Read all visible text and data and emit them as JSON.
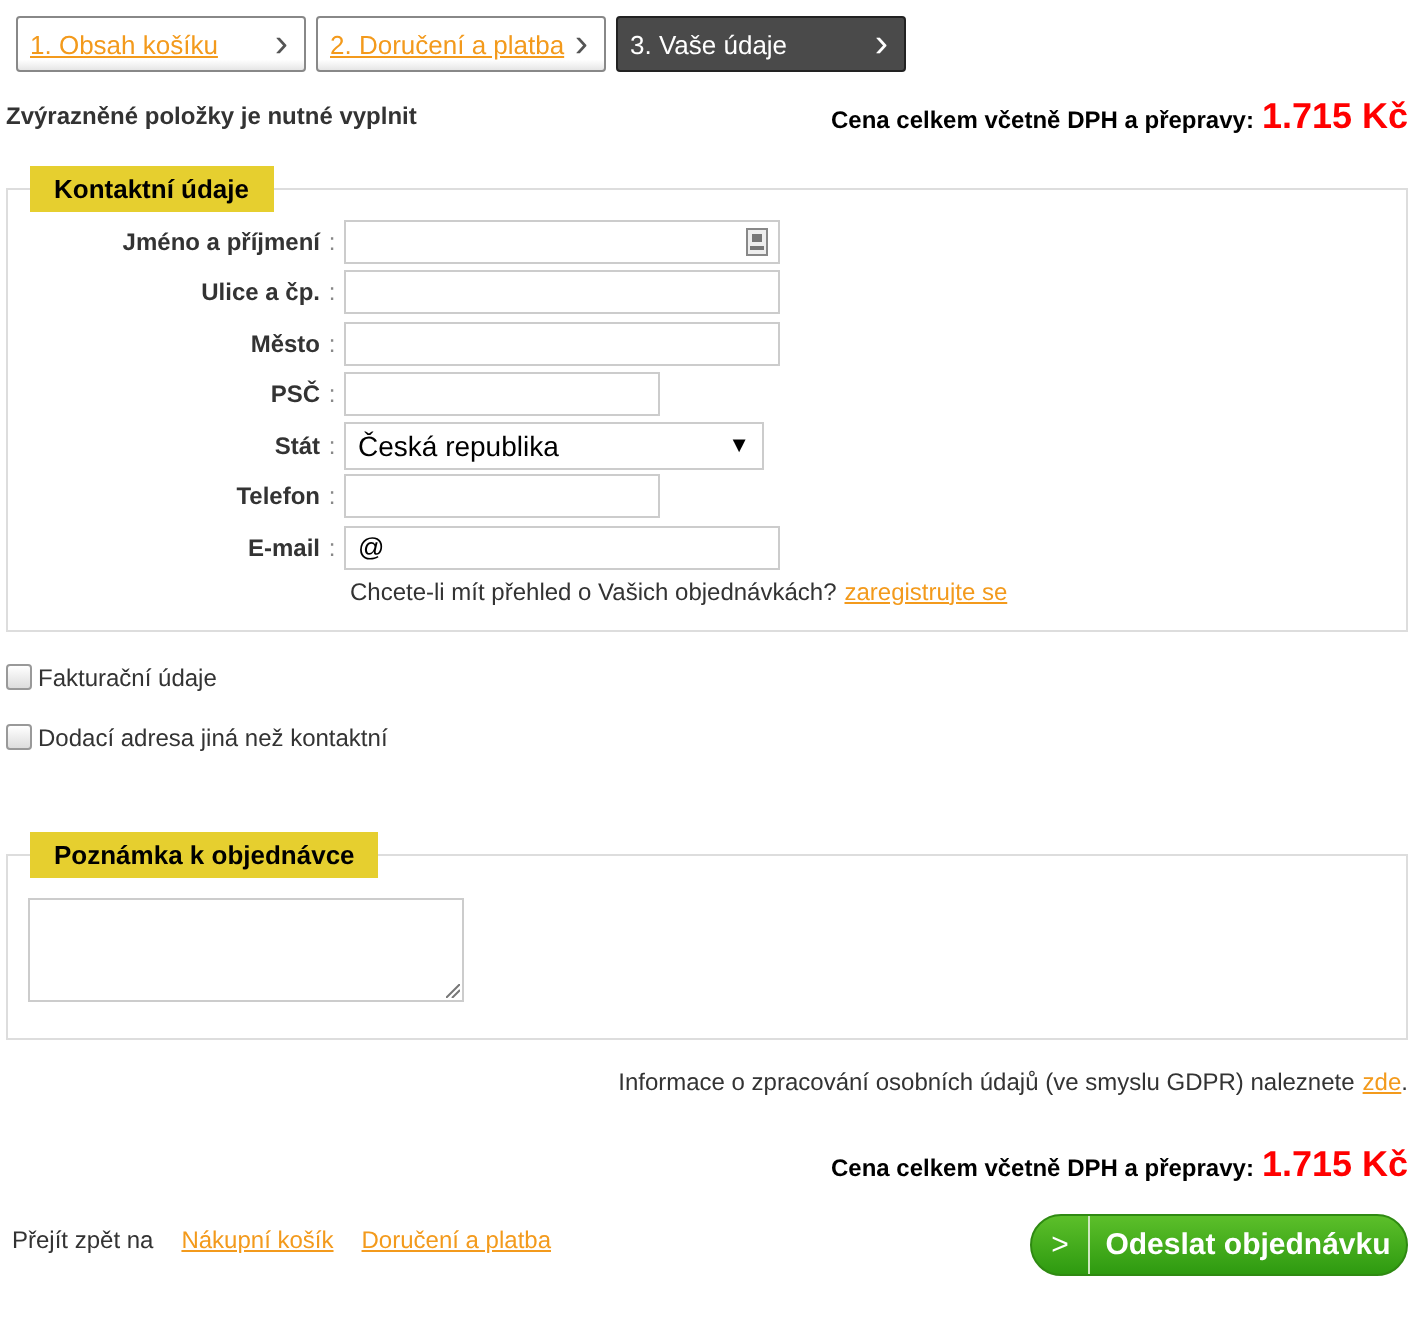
{
  "steps": [
    {
      "label": "1. Obsah košíku",
      "selected": false,
      "arrow": "›"
    },
    {
      "label": "2. Doručení a platba",
      "selected": false,
      "arrow": "›"
    },
    {
      "label": "3. Vaše údaje",
      "selected": true,
      "arrow": "›"
    }
  ],
  "required_note": "Zvýrazněné položky je nutné vyplnit",
  "total_top": {
    "label": "Cena celkem včetně DPH a přepravy:",
    "amount": "1.715 Kč"
  },
  "contact": {
    "legend": "Kontaktní údaje",
    "fields": [
      {
        "kind": "name",
        "label": "Jméno a příjmení",
        "colon": ":"
      },
      {
        "kind": "street",
        "label": "Ulice a čp.",
        "colon": ":"
      },
      {
        "kind": "city",
        "label": "Město",
        "colon": ":"
      },
      {
        "kind": "postcode",
        "label": "PSČ",
        "colon": ":"
      },
      {
        "kind": "select",
        "label": "Stát",
        "colon": ":",
        "value": "Česká republika",
        "caret": "▼"
      },
      {
        "kind": "phone",
        "label": "Telefon",
        "colon": ":"
      },
      {
        "kind": "email",
        "label": "E-mail",
        "colon": ":",
        "value": "@"
      }
    ],
    "hint": {
      "text": "Chcete-li mít přehled o Vašich objednávkách?",
      "link": "zaregistrujte se"
    }
  },
  "options": [
    {
      "label": "Fakturační údaje",
      "checked": false
    },
    {
      "label": "Dodací adresa jiná než kontaktní",
      "checked": false
    }
  ],
  "note": {
    "legend": "Poznámka k objednávce"
  },
  "gdpr": {
    "text": "Informace o zpracování osobních údajů (ve smyslu GDPR) naleznete",
    "link": "zde",
    "end": "."
  },
  "total_bottom": {
    "label": "Cena celkem včetně DPH a přepravy:",
    "amount": "1.715 Kč"
  },
  "back": {
    "label": "Přejít zpět na",
    "links": [
      "Nákupní košík",
      "Doručení a platba"
    ]
  },
  "submit": {
    "arrow": ">",
    "label": "Odeslat objednávku"
  }
}
